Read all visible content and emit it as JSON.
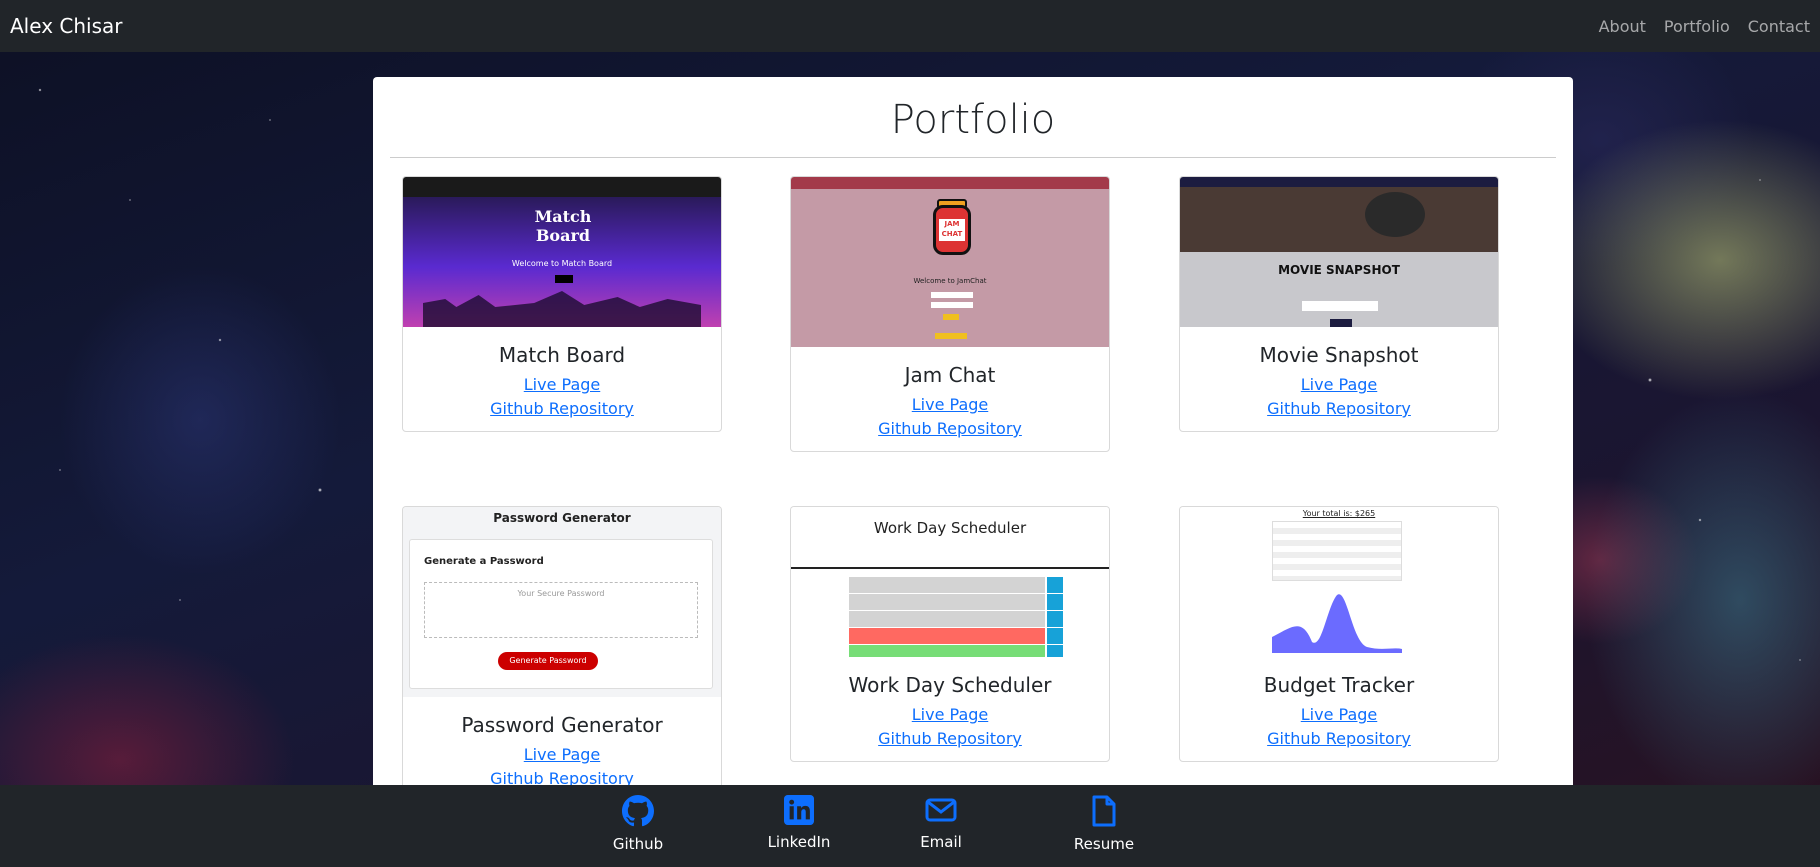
{
  "navbar": {
    "brand": "Alex Chisar",
    "links": [
      "About",
      "Portfolio",
      "Contact"
    ]
  },
  "portfolio": {
    "title": "Portfolio",
    "projects": [
      {
        "name": "Match Board",
        "live_label": "Live Page",
        "repo_label": "Github Repository"
      },
      {
        "name": "Jam Chat",
        "live_label": "Live Page",
        "repo_label": "Github Repository"
      },
      {
        "name": "Movie Snapshot",
        "live_label": "Live Page",
        "repo_label": "Github Repository"
      },
      {
        "name": "Password Generator",
        "live_label": "Live Page",
        "repo_label": "Github Repository"
      },
      {
        "name": "Work Day Scheduler",
        "live_label": "Live Page",
        "repo_label": "Github Repository"
      },
      {
        "name": "Budget Tracker",
        "live_label": "Live Page",
        "repo_label": "Github Repository"
      }
    ]
  },
  "thumbnails": {
    "match_board": {
      "welcome": "Welcome to Match Board",
      "logo": "Match Board"
    },
    "jam_chat": {
      "welcome": "Welcome to JamChat",
      "jar_label": "JAM CHAT"
    },
    "movie_snapshot": {
      "title": "MOVIE SNAPSHOT"
    },
    "password_generator": {
      "heading": "Password Generator",
      "subheading": "Generate a Password",
      "placeholder": "Your Secure Password",
      "button": "Generate Password"
    },
    "work_day": {
      "heading": "Work Day Scheduler"
    },
    "budget": {
      "heading": "Your total is: $265"
    }
  },
  "footer": {
    "items": [
      {
        "label": "Github",
        "icon": "github-icon"
      },
      {
        "label": "LinkedIn",
        "icon": "linkedin-icon"
      },
      {
        "label": "Email",
        "icon": "envelope-icon"
      },
      {
        "label": "Resume",
        "icon": "document-icon"
      }
    ]
  },
  "colors": {
    "navbar_bg": "#212529",
    "link": "#0d6efd",
    "footer_icon": "#0d6efd"
  }
}
